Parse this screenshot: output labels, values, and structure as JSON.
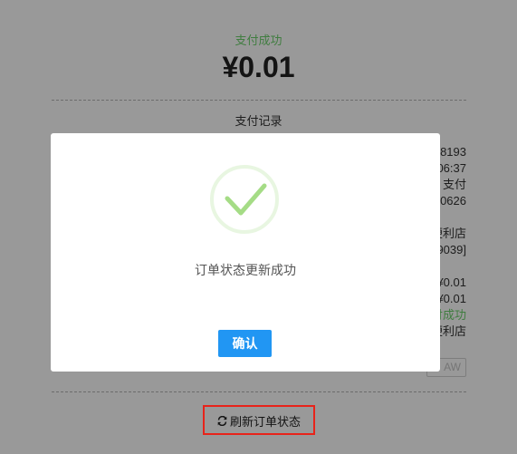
{
  "page": {
    "status": "支付成功",
    "amount": "¥0.01",
    "record_title": "支付记录",
    "records": [
      [
        "8193",
        "06:37",
        "支付",
        "0626"
      ],
      [
        "便利店",
        "9039]"
      ],
      [
        "¥0.01",
        "¥0.01",
        "付成功",
        "便利店"
      ]
    ],
    "side_button": "AW",
    "refresh_label": "刷新订单状态"
  },
  "dialog": {
    "message": "订单状态更新成功",
    "confirm_label": "确认"
  },
  "icons": {
    "dialog": "success-check-icon",
    "refresh": "refresh-icon"
  },
  "colors": {
    "success": "#6cd06c",
    "accent": "#2196f3",
    "highlight": "#e8231a",
    "check": "#a5dc86"
  }
}
